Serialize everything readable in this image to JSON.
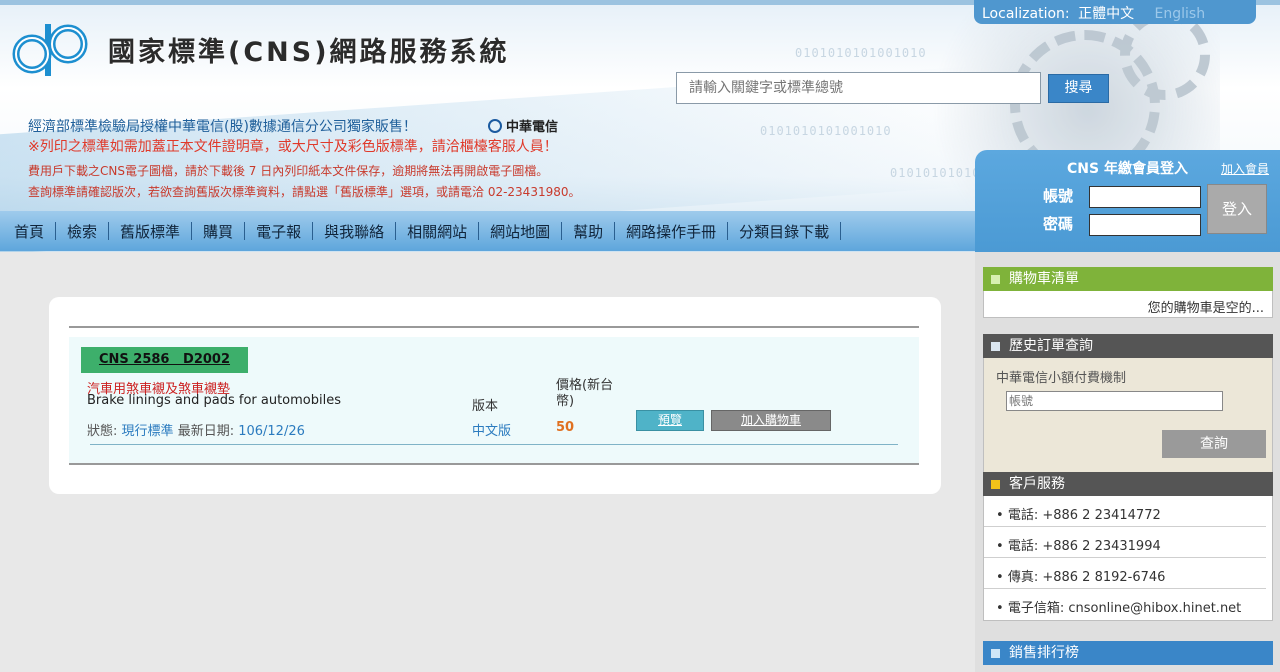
{
  "header": {
    "site_title": "國家標準(CNS)網路服務系統",
    "localization_label": "Localization:",
    "lang_active": "正體中文",
    "lang_inactive": "English",
    "search_placeholder": "請輸入關鍵字或標準總號",
    "search_button": "搜尋",
    "notice_authorized": "經濟部標準檢驗局授權中華電信(股)數據通信分公司獨家販售！",
    "cht_brand": "中華電信",
    "notice_red": "※列印之標準如需加蓋正本文件證明章，或大尺寸及彩色版標準，請洽櫃檯客服人員！",
    "notice_download": "費用戶下載之CNS電子圖檔，請於下載後 7 日內列印紙本文件保存，逾期將無法再開啟電子圖檔。",
    "notice_query": "查詢標準請確認版次，若欲查詢舊版次標準資料，請點選「舊版標準」選項，或請電洽 02-23431980。",
    "binary_text": "0101010101001010"
  },
  "nav": {
    "items": [
      "首頁",
      "檢索",
      "舊版標準",
      "購買",
      "電子報",
      "與我聯絡",
      "相關網站",
      "網站地圖",
      "幫助",
      "網路操作手冊",
      "分類目錄下載"
    ]
  },
  "login": {
    "title": "CNS 年繳會員登入",
    "join_link": "加入會員",
    "account_label": "帳號",
    "password_label": "密碼",
    "login_button": "登入"
  },
  "result": {
    "code": "CNS 2586   D2002",
    "title_zh": "汽車用煞車襯及煞車襯墊",
    "title_en": "Brake linings and pads for automobiles",
    "status_label": "狀態:",
    "status_value": "現行標準",
    "date_label": "最新日期:",
    "date_value": "106/12/26",
    "version_label": "版本",
    "version_value": "中文版",
    "price_label": "價格(新台幣)",
    "price_value": "50",
    "preview_button": "預覽",
    "add_cart_button": "加入購物車"
  },
  "sidebar": {
    "cart_title": "購物車清單",
    "cart_empty": "您的購物車是空的...",
    "history_title": "歷史訂單查詢",
    "history_text": "中華電信小額付費機制",
    "history_placeholder": "帳號",
    "history_button": "查詢",
    "service_title": "客戶服務",
    "service_items": [
      "電話: +886 2 23414772",
      "電話: +886 2 23431994",
      "傳真: +886 2 8192-6746",
      "電子信箱: cnsonline@hibox.hinet.net"
    ],
    "ranking_title": "銷售排行榜"
  },
  "colors": {
    "nav_blue": "#5ea6dc",
    "cns_green": "#3daf6b",
    "cart_green": "#7fb33a",
    "price_orange": "#e07020",
    "link_blue": "#2b7bbf"
  }
}
